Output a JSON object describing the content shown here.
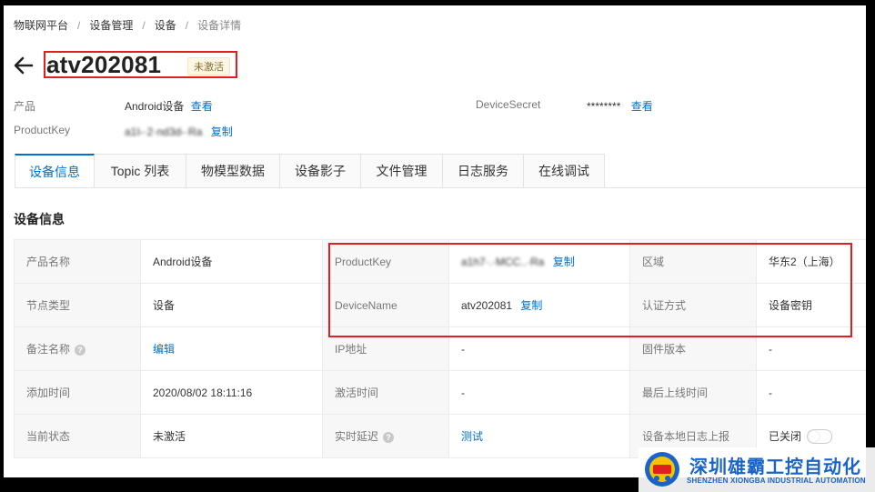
{
  "breadcrumb": {
    "items": [
      "物联网平台",
      "设备管理",
      "设备"
    ],
    "current": "设备详情"
  },
  "header": {
    "title": "atv202081",
    "status": "未激活",
    "product_label": "产品",
    "product_value": "Android设备",
    "product_link": "查看",
    "productkey_label": "ProductKey",
    "productkey_value": "a1I-·2·nd3d-·Ra",
    "productkey_link": "复制",
    "secret_label": "DeviceSecret",
    "secret_value": "********",
    "secret_link": "查看"
  },
  "tabs": [
    "设备信息",
    "Topic 列表",
    "物模型数据",
    "设备影子",
    "文件管理",
    "日志服务",
    "在线调试"
  ],
  "section_title": "设备信息",
  "info": {
    "product_name_label": "产品名称",
    "product_name": "Android设备",
    "productkey_label": "ProductKey",
    "productkey": "a1h7·.·MCC..·Ra",
    "productkey_copy": "复制",
    "region_label": "区域",
    "region": "华东2（上海）",
    "node_type_label": "节点类型",
    "node_type": "设备",
    "devicename_label": "DeviceName",
    "devicename": "atv202081",
    "devicename_copy": "复制",
    "auth_label": "认证方式",
    "auth": "设备密钥",
    "remark_label": "备注名称",
    "remark_edit": "编辑",
    "ip_label": "IP地址",
    "ip": "-",
    "firmware_label": "固件版本",
    "firmware": "-",
    "added_label": "添加时间",
    "added": "2020/08/02 18:11:16",
    "activated_label": "激活时间",
    "activated": "-",
    "last_online_label": "最后上线时间",
    "last_online": "-",
    "state_label": "当前状态",
    "state": "未激活",
    "latency_label": "实时延迟",
    "latency_test": "测试",
    "local_log_label": "设备本地日志上报",
    "local_log": "已关闭"
  },
  "watermark": {
    "cn": "深圳雄霸工控自动化",
    "en": "SHENZHEN XIONGBA INDUSTRIAL AUTOMATION"
  },
  "colors": {
    "link": "#0070cc",
    "highlight": "#e02020",
    "watermark": "#1a63c9"
  },
  "icons": [
    "back-arrow-icon",
    "help-icon",
    "toggle-switch"
  ]
}
